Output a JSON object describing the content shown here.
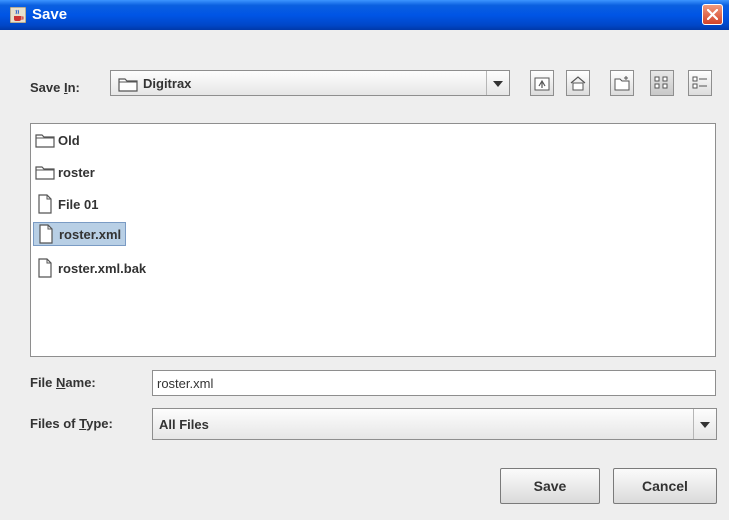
{
  "window": {
    "title": "Save",
    "icon": "java-cup-icon",
    "close_icon": "close-icon"
  },
  "save_in": {
    "label_prefix": "Save ",
    "label_mnemonic": "I",
    "label_suffix": "n:",
    "value": "Digitrax",
    "icon": "folder-icon"
  },
  "toolbar": {
    "buttons": [
      {
        "icon": "up-one-level-icon"
      },
      {
        "icon": "home-icon"
      },
      {
        "icon": "new-folder-icon"
      },
      {
        "icon": "list-view-icon",
        "selected": true
      },
      {
        "icon": "details-view-icon"
      }
    ]
  },
  "files": [
    {
      "name": "Old",
      "type": "folder"
    },
    {
      "name": "roster",
      "type": "folder"
    },
    {
      "name": "File 01",
      "type": "file"
    },
    {
      "name": "roster.xml",
      "type": "file",
      "selected": true
    },
    {
      "name": "roster.xml.bak",
      "type": "file"
    }
  ],
  "file_name": {
    "label_prefix": "File ",
    "label_mnemonic": "N",
    "label_suffix": "ame:",
    "value": "roster.xml"
  },
  "file_type": {
    "label_prefix": "Files of ",
    "label_mnemonic": "T",
    "label_suffix": "ype:",
    "value": "All Files"
  },
  "buttons": {
    "save": "Save",
    "cancel": "Cancel"
  },
  "colors": {
    "titlebar": "#0055e5",
    "selection": "#b8cfe5",
    "dialog_bg": "#eeeeee",
    "close": "#d2432a"
  }
}
